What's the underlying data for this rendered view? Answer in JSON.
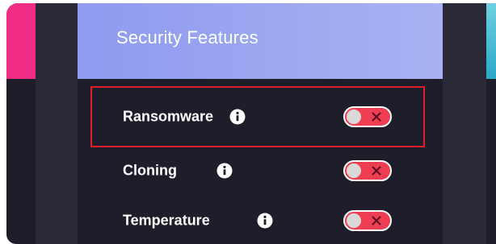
{
  "panel": {
    "title": "Security Features"
  },
  "features": [
    {
      "label": "Ransomware",
      "enabled": false,
      "selected": true,
      "info_icon": "info-icon",
      "toggle_icon": "x-icon"
    },
    {
      "label": "Cloning",
      "enabled": false,
      "selected": false,
      "info_icon": "info-icon",
      "toggle_icon": "x-icon"
    },
    {
      "label": "Temperature",
      "enabled": false,
      "selected": false,
      "info_icon": "info-icon",
      "toggle_icon": "x-icon"
    }
  ],
  "colors": {
    "header_start": "#8e9bef",
    "header_end": "#a8b2f2",
    "background": "#1e1d2a",
    "toggle_off": "#ef3d52",
    "selection_outline": "#e01f2a",
    "left_accent": "#f02c86",
    "right_accent": "#2aa9c8"
  }
}
